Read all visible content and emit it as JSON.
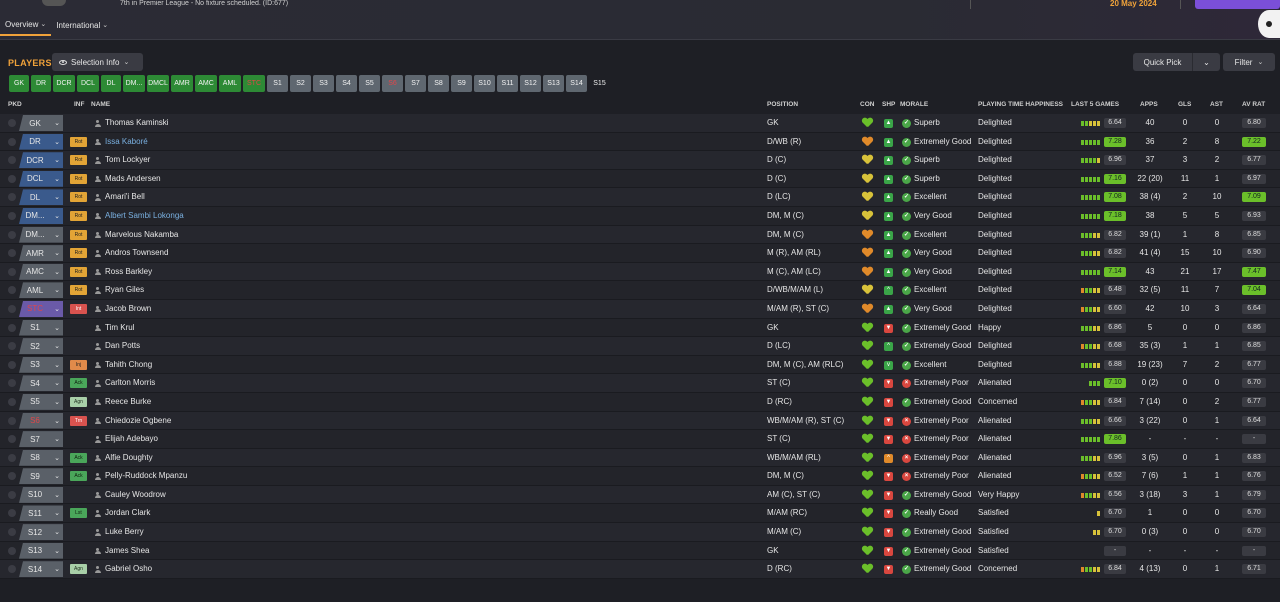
{
  "header": {
    "status_text": "7th in Premier League - No fixture scheduled. (ID:677)",
    "date": "20 May 2024",
    "tabs": [
      {
        "label": "Overview",
        "active": true
      },
      {
        "label": "International",
        "active": false
      }
    ]
  },
  "toolbar": {
    "players_label": "PLAYERS",
    "selection_info": "Selection Info",
    "quick_pick": "Quick Pick",
    "filter": "Filter"
  },
  "chips": [
    {
      "label": "GK",
      "style": "g"
    },
    {
      "label": "DR",
      "style": "g"
    },
    {
      "label": "DCR",
      "style": "g"
    },
    {
      "label": "DCL",
      "style": "g"
    },
    {
      "label": "DL",
      "style": "g"
    },
    {
      "label": "DM...",
      "style": "g"
    },
    {
      "label": "DMCL",
      "style": "g"
    },
    {
      "label": "AMR",
      "style": "g"
    },
    {
      "label": "AMC",
      "style": "g"
    },
    {
      "label": "AML",
      "style": "g"
    },
    {
      "label": "STC",
      "style": "g"
    },
    {
      "label": "S1",
      "style": "s"
    },
    {
      "label": "S2",
      "style": "s"
    },
    {
      "label": "S3",
      "style": "s"
    },
    {
      "label": "S4",
      "style": "s"
    },
    {
      "label": "S5",
      "style": "s"
    },
    {
      "label": "S6",
      "style": "s"
    },
    {
      "label": "S7",
      "style": "s"
    },
    {
      "label": "S8",
      "style": "s"
    },
    {
      "label": "S9",
      "style": "s"
    },
    {
      "label": "S10",
      "style": "s"
    },
    {
      "label": "S11",
      "style": "s"
    },
    {
      "label": "S12",
      "style": "s"
    },
    {
      "label": "S13",
      "style": "s"
    },
    {
      "label": "S14",
      "style": "s"
    },
    {
      "label": "S15",
      "style": "d"
    }
  ],
  "columns": {
    "pkd": "PKD",
    "inf": "INF",
    "name": "NAME",
    "position": "POSITION",
    "con": "CON",
    "shp": "SHP",
    "morale": "MORALE",
    "pth": "PLAYING TIME HAPPINESS",
    "last5": "LAST 5 GAMES",
    "apps": "APPS",
    "gls": "GLS",
    "ast": "AST",
    "avrat": "AV RAT"
  },
  "colors": {
    "accent": "#f0a23a",
    "green": "#6bbf2a",
    "red": "#e0464a",
    "yellow": "#d8c23a",
    "orange": "#e08a2a"
  },
  "players": [
    {
      "slot": "GK",
      "slot_style": "grey",
      "inf": "",
      "name": "Thomas Kaminski",
      "link": false,
      "position": "GK",
      "con": "green",
      "shp": "green-up",
      "morale_icon": "green",
      "morale": "Superb",
      "pth": "Delighted",
      "last5": [
        "g",
        "g",
        "y",
        "y",
        "y"
      ],
      "last5_rating": "6.64",
      "last5_hi": false,
      "apps": "40",
      "gls": "0",
      "ast": "0",
      "avrat": "6.80",
      "avrat_hi": false
    },
    {
      "slot": "DR",
      "slot_style": "blue",
      "inf": "Rot",
      "name": "Issa Kaboré",
      "link": true,
      "position": "D/WB (R)",
      "con": "orange",
      "shp": "green-up",
      "morale_icon": "green",
      "morale": "Extremely Good",
      "pth": "Delighted",
      "last5": [
        "g",
        "g",
        "g",
        "g",
        "g"
      ],
      "last5_rating": "7.28",
      "last5_hi": true,
      "apps": "36",
      "gls": "2",
      "ast": "8",
      "avrat": "7.22",
      "avrat_hi": true
    },
    {
      "slot": "DCR",
      "slot_style": "blue",
      "inf": "Rot",
      "name": "Tom Lockyer",
      "link": false,
      "position": "D (C)",
      "con": "yellow",
      "shp": "green-up",
      "morale_icon": "green",
      "morale": "Superb",
      "pth": "Delighted",
      "last5": [
        "g",
        "g",
        "g",
        "g",
        "y"
      ],
      "last5_rating": "6.96",
      "last5_hi": false,
      "apps": "37",
      "gls": "3",
      "ast": "2",
      "avrat": "6.77",
      "avrat_hi": false
    },
    {
      "slot": "DCL",
      "slot_style": "blue",
      "inf": "Rot",
      "name": "Mads Andersen",
      "link": false,
      "position": "D (C)",
      "con": "yellow",
      "shp": "green-up",
      "morale_icon": "green",
      "morale": "Superb",
      "pth": "Delighted",
      "last5": [
        "g",
        "g",
        "g",
        "g",
        "g"
      ],
      "last5_rating": "7.16",
      "last5_hi": true,
      "apps": "22 (20)",
      "gls": "11",
      "ast": "1",
      "avrat": "6.97",
      "avrat_hi": false
    },
    {
      "slot": "DL",
      "slot_style": "blue",
      "inf": "Rot",
      "name": "Amari'i Bell",
      "link": false,
      "position": "D (LC)",
      "con": "yellow",
      "shp": "green-up",
      "morale_icon": "green",
      "morale": "Excellent",
      "pth": "Delighted",
      "last5": [
        "g",
        "g",
        "g",
        "g",
        "g"
      ],
      "last5_rating": "7.08",
      "last5_hi": true,
      "apps": "38 (4)",
      "gls": "2",
      "ast": "10",
      "avrat": "7.09",
      "avrat_hi": true
    },
    {
      "slot": "DM...",
      "slot_style": "blue",
      "inf": "Rot",
      "name": "Albert Sambi Lokonga",
      "link": true,
      "position": "DM, M (C)",
      "con": "yellow",
      "shp": "green-up",
      "morale_icon": "green",
      "morale": "Very Good",
      "pth": "Delighted",
      "last5": [
        "g",
        "g",
        "g",
        "g",
        "g"
      ],
      "last5_rating": "7.18",
      "last5_hi": true,
      "apps": "38",
      "gls": "5",
      "ast": "5",
      "avrat": "6.93",
      "avrat_hi": false
    },
    {
      "slot": "DM...",
      "slot_style": "grey",
      "inf": "Rot",
      "name": "Marvelous Nakamba",
      "link": false,
      "position": "DM, M (C)",
      "con": "orange",
      "shp": "green-up",
      "morale_icon": "green",
      "morale": "Excellent",
      "pth": "Delighted",
      "last5": [
        "g",
        "g",
        "g",
        "y",
        "y"
      ],
      "last5_rating": "6.82",
      "last5_hi": false,
      "apps": "39 (1)",
      "gls": "1",
      "ast": "8",
      "avrat": "6.85",
      "avrat_hi": false
    },
    {
      "slot": "AMR",
      "slot_style": "grey",
      "inf": "Rot",
      "name": "Andros Townsend",
      "link": false,
      "position": "M (R), AM (RL)",
      "con": "orange",
      "shp": "green-up",
      "morale_icon": "green",
      "morale": "Very Good",
      "pth": "Delighted",
      "last5": [
        "g",
        "g",
        "g",
        "y",
        "y"
      ],
      "last5_rating": "6.82",
      "last5_hi": false,
      "apps": "41 (4)",
      "gls": "15",
      "ast": "10",
      "avrat": "6.90",
      "avrat_hi": false
    },
    {
      "slot": "AMC",
      "slot_style": "grey",
      "inf": "Rot",
      "name": "Ross Barkley",
      "link": false,
      "position": "M (C), AM (LC)",
      "con": "orange",
      "shp": "green-up",
      "morale_icon": "green",
      "morale": "Very Good",
      "pth": "Delighted",
      "last5": [
        "g",
        "g",
        "g",
        "g",
        "g"
      ],
      "last5_rating": "7.14",
      "last5_hi": true,
      "apps": "43",
      "gls": "21",
      "ast": "17",
      "avrat": "7.47",
      "avrat_hi": true
    },
    {
      "slot": "AML",
      "slot_style": "grey",
      "inf": "Rot",
      "name": "Ryan Giles",
      "link": false,
      "position": "D/WB/M/AM (L)",
      "con": "yellow",
      "shp": "green-flat",
      "morale_icon": "green",
      "morale": "Excellent",
      "pth": "Delighted",
      "last5": [
        "o",
        "g",
        "g",
        "y",
        "y"
      ],
      "last5_rating": "6.48",
      "last5_hi": false,
      "apps": "32 (5)",
      "gls": "11",
      "ast": "7",
      "avrat": "7.04",
      "avrat_hi": true
    },
    {
      "slot": "STC",
      "slot_style": "purple",
      "slot_red": true,
      "inf": "Int",
      "name": "Jacob Brown",
      "link": false,
      "position": "M/AM (R), ST (C)",
      "con": "orange",
      "shp": "green-up",
      "morale_icon": "green",
      "morale": "Very Good",
      "pth": "Delighted",
      "last5": [
        "o",
        "g",
        "g",
        "y",
        "y"
      ],
      "last5_rating": "6.60",
      "last5_hi": false,
      "apps": "42",
      "gls": "10",
      "ast": "3",
      "avrat": "6.64",
      "avrat_hi": false
    },
    {
      "slot": "S1",
      "slot_style": "grey",
      "inf": "",
      "name": "Tim Krul",
      "link": false,
      "position": "GK",
      "con": "green",
      "shp": "red",
      "morale_icon": "green",
      "morale": "Extremely Good",
      "pth": "Happy",
      "last5": [
        "g",
        "g",
        "g",
        "y",
        "y"
      ],
      "last5_rating": "6.86",
      "last5_hi": false,
      "apps": "5",
      "gls": "0",
      "ast": "0",
      "avrat": "6.86",
      "avrat_hi": false
    },
    {
      "slot": "S2",
      "slot_style": "grey",
      "inf": "",
      "name": "Dan Potts",
      "link": false,
      "position": "D (LC)",
      "con": "green",
      "shp": "green-flat",
      "morale_icon": "green",
      "morale": "Extremely Good",
      "pth": "Delighted",
      "last5": [
        "o",
        "g",
        "g",
        "y",
        "y"
      ],
      "last5_rating": "6.68",
      "last5_hi": false,
      "apps": "35 (3)",
      "gls": "1",
      "ast": "1",
      "avrat": "6.85",
      "avrat_hi": false
    },
    {
      "slot": "S3",
      "slot_style": "grey",
      "inf": "Inj",
      "name": "Tahith Chong",
      "link": false,
      "position": "DM, M (C), AM (RLC)",
      "con": "green",
      "shp": "green-down",
      "morale_icon": "green",
      "morale": "Excellent",
      "pth": "Delighted",
      "last5": [
        "g",
        "g",
        "g",
        "y",
        "y"
      ],
      "last5_rating": "6.88",
      "last5_hi": false,
      "apps": "19 (23)",
      "gls": "7",
      "ast": "2",
      "avrat": "6.77",
      "avrat_hi": false
    },
    {
      "slot": "S4",
      "slot_style": "grey",
      "inf": "Ack",
      "name": "Carlton Morris",
      "link": false,
      "position": "ST (C)",
      "con": "green",
      "shp": "red",
      "morale_icon": "red",
      "morale": "Extremely Poor",
      "pth": "Alienated",
      "last5": [
        "g",
        "g",
        "g"
      ],
      "last5_rating": "7.10",
      "last5_hi": true,
      "apps": "0 (2)",
      "gls": "0",
      "ast": "0",
      "avrat": "6.70",
      "avrat_hi": false
    },
    {
      "slot": "S5",
      "slot_style": "grey",
      "inf": "Agn",
      "name": "Reece Burke",
      "link": false,
      "position": "D (RC)",
      "con": "green",
      "shp": "red",
      "morale_icon": "green",
      "morale": "Extremely Good",
      "pth": "Concerned",
      "last5": [
        "o",
        "g",
        "g",
        "y",
        "y"
      ],
      "last5_rating": "6.84",
      "last5_hi": false,
      "apps": "7 (14)",
      "gls": "0",
      "ast": "2",
      "avrat": "6.77",
      "avrat_hi": false
    },
    {
      "slot": "S6",
      "slot_style": "grey",
      "slot_red": true,
      "inf": "Trn",
      "name": "Chiedozie Ogbene",
      "link": false,
      "position": "WB/M/AM (R), ST (C)",
      "con": "green",
      "shp": "red",
      "morale_icon": "red",
      "morale": "Extremely Poor",
      "pth": "Alienated",
      "last5": [
        "g",
        "g",
        "g",
        "y",
        "y"
      ],
      "last5_rating": "6.66",
      "last5_hi": false,
      "apps": "3 (22)",
      "gls": "0",
      "ast": "1",
      "avrat": "6.64",
      "avrat_hi": false
    },
    {
      "slot": "S7",
      "slot_style": "grey",
      "inf": "",
      "name": "Elijah Adebayo",
      "link": false,
      "position": "ST (C)",
      "con": "green",
      "shp": "red",
      "morale_icon": "red",
      "morale": "Extremely Poor",
      "pth": "Alienated",
      "last5": [
        "g",
        "g",
        "g",
        "g",
        "g"
      ],
      "last5_rating": "7.86",
      "last5_hi": true,
      "apps": "-",
      "gls": "-",
      "ast": "-",
      "avrat": "-",
      "avrat_hi": false
    },
    {
      "slot": "S8",
      "slot_style": "grey",
      "inf": "Ack",
      "name": "Alfie Doughty",
      "link": false,
      "position": "WB/M/AM (RL)",
      "con": "green",
      "shp": "orange-up",
      "morale_icon": "red",
      "morale": "Extremely Poor",
      "pth": "Alienated",
      "last5": [
        "g",
        "g",
        "g",
        "y",
        "y"
      ],
      "last5_rating": "6.96",
      "last5_hi": false,
      "apps": "3 (5)",
      "gls": "0",
      "ast": "1",
      "avrat": "6.83",
      "avrat_hi": false
    },
    {
      "slot": "S9",
      "slot_style": "grey",
      "inf": "Ack",
      "name": "Pelly-Ruddock Mpanzu",
      "link": false,
      "position": "DM, M (C)",
      "con": "green",
      "shp": "red",
      "morale_icon": "red",
      "morale": "Extremely Poor",
      "pth": "Alienated",
      "last5": [
        "o",
        "g",
        "g",
        "y",
        "y"
      ],
      "last5_rating": "6.52",
      "last5_hi": false,
      "apps": "7 (6)",
      "gls": "1",
      "ast": "1",
      "avrat": "6.76",
      "avrat_hi": false
    },
    {
      "slot": "S10",
      "slot_style": "grey",
      "inf": "",
      "name": "Cauley Woodrow",
      "link": false,
      "position": "AM (C), ST (C)",
      "con": "green",
      "shp": "red",
      "morale_icon": "green",
      "morale": "Extremely Good",
      "pth": "Very Happy",
      "last5": [
        "o",
        "g",
        "g",
        "y",
        "y"
      ],
      "last5_rating": "6.56",
      "last5_hi": false,
      "apps": "3 (18)",
      "gls": "3",
      "ast": "1",
      "avrat": "6.79",
      "avrat_hi": false
    },
    {
      "slot": "S11",
      "slot_style": "grey",
      "inf": "Lst",
      "name": "Jordan Clark",
      "link": false,
      "position": "M/AM (RC)",
      "con": "green",
      "shp": "red",
      "morale_icon": "green",
      "morale": "Really Good",
      "pth": "Satisfied",
      "last5": [
        "y"
      ],
      "last5_rating": "6.70",
      "last5_hi": false,
      "apps": "1",
      "gls": "0",
      "ast": "0",
      "avrat": "6.70",
      "avrat_hi": false
    },
    {
      "slot": "S12",
      "slot_style": "grey",
      "inf": "",
      "name": "Luke Berry",
      "link": false,
      "position": "M/AM (C)",
      "con": "green",
      "shp": "red",
      "morale_icon": "green",
      "morale": "Extremely Good",
      "pth": "Satisfied",
      "last5": [
        "y",
        "y"
      ],
      "last5_rating": "6.70",
      "last5_hi": false,
      "apps": "0 (3)",
      "gls": "0",
      "ast": "0",
      "avrat": "6.70",
      "avrat_hi": false
    },
    {
      "slot": "S13",
      "slot_style": "grey",
      "inf": "",
      "name": "James Shea",
      "link": false,
      "position": "GK",
      "con": "green",
      "shp": "red",
      "morale_icon": "green",
      "morale": "Extremely Good",
      "pth": "Satisfied",
      "last5": [],
      "last5_rating": "-",
      "last5_hi": false,
      "apps": "-",
      "gls": "-",
      "ast": "-",
      "avrat": "-",
      "avrat_hi": false
    },
    {
      "slot": "S14",
      "slot_style": "grey",
      "inf": "Agn",
      "name": "Gabriel Osho",
      "link": false,
      "position": "D (RC)",
      "con": "green",
      "shp": "red",
      "morale_icon": "green",
      "morale": "Extremely Good",
      "pth": "Concerned",
      "last5": [
        "o",
        "g",
        "g",
        "y",
        "y"
      ],
      "last5_rating": "6.84",
      "last5_hi": false,
      "apps": "4 (13)",
      "gls": "0",
      "ast": "1",
      "avrat": "6.71",
      "avrat_hi": false
    }
  ]
}
